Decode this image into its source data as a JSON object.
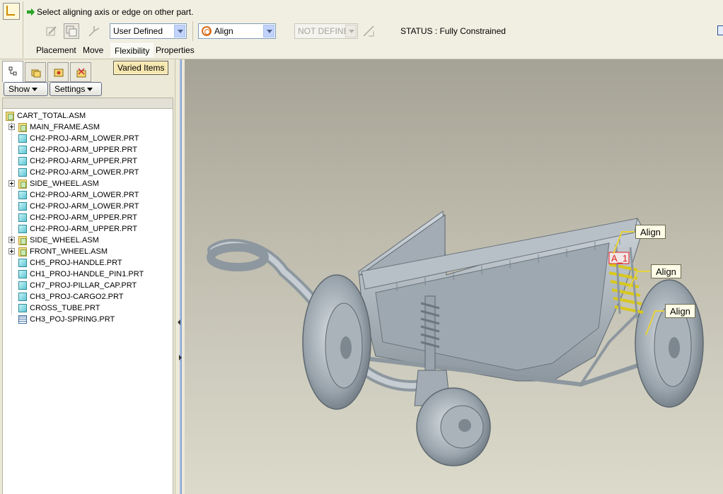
{
  "dashboard": {
    "message": "Select aligning axis or edge on other part.",
    "icons": [
      "assembly-place-icon",
      "user-defined-set-icon",
      "copy-part-icon",
      "datum-axis-icon",
      "flip-icon"
    ],
    "set_type": "User Defined",
    "constraint_type": "Align",
    "offset_value": "NOT DEFINE",
    "status": "STATUS : Fully Constrained",
    "tabs": [
      "Placement",
      "Move",
      "Flexibility",
      "Properties"
    ],
    "active_tab": "Flexibility"
  },
  "left_panel": {
    "nav_tab_icons": [
      "model-tree-icon",
      "folder-browser-icon",
      "favorites-icon",
      "connections-icon"
    ],
    "varied_items_label": "Varied Items",
    "show_label": "Show",
    "settings_label": "Settings"
  },
  "tree": {
    "root": "CART_TOTAL.ASM",
    "items": [
      {
        "label": "MAIN_FRAME.ASM",
        "type": "asm",
        "expandable": true
      },
      {
        "label": "CH2-PROJ-ARM_LOWER.PRT",
        "type": "prt",
        "expandable": false
      },
      {
        "label": "CH2-PROJ-ARM_UPPER.PRT",
        "type": "prt",
        "expandable": false
      },
      {
        "label": "CH2-PROJ-ARM_UPPER.PRT",
        "type": "prt",
        "expandable": false
      },
      {
        "label": "CH2-PROJ-ARM_LOWER.PRT",
        "type": "prt",
        "expandable": false
      },
      {
        "label": "SIDE_WHEEL.ASM",
        "type": "asm",
        "expandable": true
      },
      {
        "label": "CH2-PROJ-ARM_LOWER.PRT",
        "type": "prt",
        "expandable": false
      },
      {
        "label": "CH2-PROJ-ARM_LOWER.PRT",
        "type": "prt",
        "expandable": false
      },
      {
        "label": "CH2-PROJ-ARM_UPPER.PRT",
        "type": "prt",
        "expandable": false
      },
      {
        "label": "CH2-PROJ-ARM_UPPER.PRT",
        "type": "prt",
        "expandable": false
      },
      {
        "label": "SIDE_WHEEL.ASM",
        "type": "asm",
        "expandable": true
      },
      {
        "label": "FRONT_WHEEL.ASM",
        "type": "asm",
        "expandable": true
      },
      {
        "label": "CH5_PROJ-HANDLE.PRT",
        "type": "prt",
        "expandable": false
      },
      {
        "label": "CH1_PROJ-HANDLE_PIN1.PRT",
        "type": "prt",
        "expandable": false
      },
      {
        "label": "CH7_PROJ-PILLAR_CAP.PRT",
        "type": "prt",
        "expandable": false
      },
      {
        "label": "CH3_PROJ-CARGO2.PRT",
        "type": "prt",
        "expandable": false
      },
      {
        "label": "CROSS_TUBE.PRT",
        "type": "prt",
        "expandable": false
      },
      {
        "label": "CH3_POJ-SPRING.PRT",
        "type": "spring",
        "expandable": false
      }
    ]
  },
  "viewport": {
    "callouts": [
      "Align",
      "Align",
      "Align"
    ],
    "constraint_marker": "A_1"
  },
  "colors": {
    "callout_line": "#e8d23a",
    "model": "#b9c1c8",
    "spring_highlight": "#d8c81c",
    "marker": "#e02020"
  }
}
